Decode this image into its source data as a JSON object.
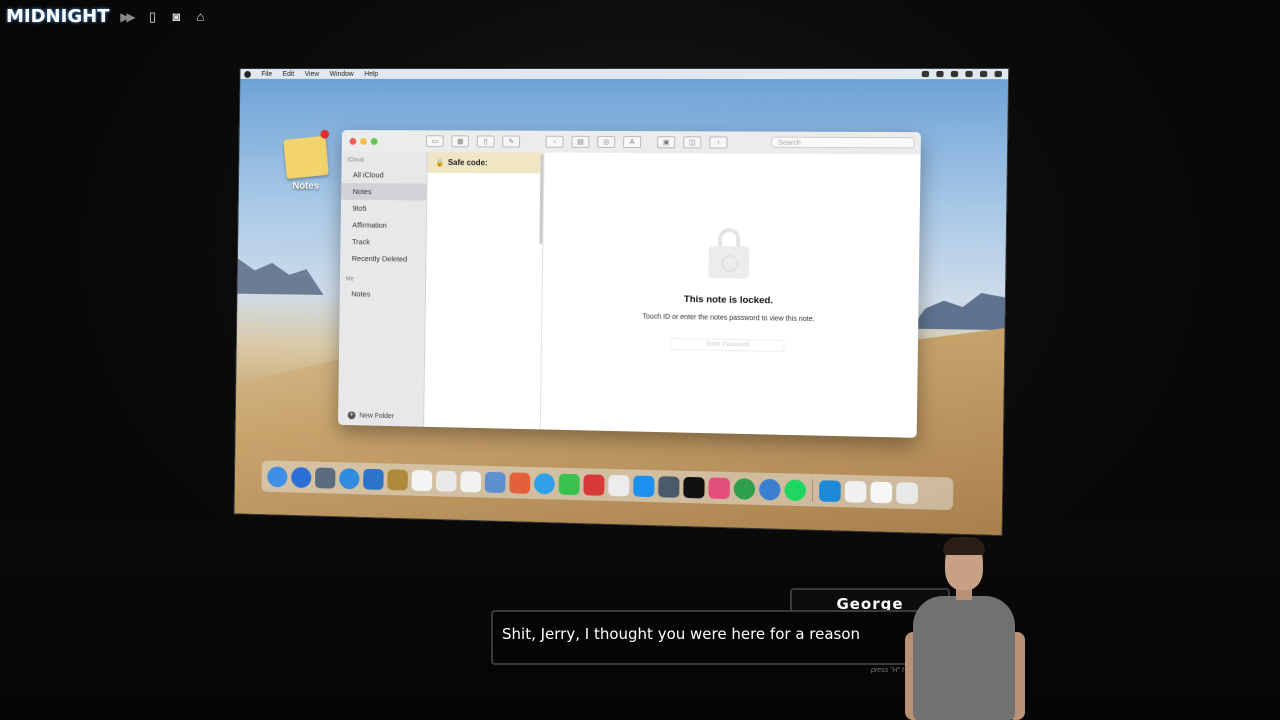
{
  "game": {
    "logo": "MIDNIGHT",
    "hud_icons": [
      "skip-icon",
      "phone-icon",
      "bag-icon",
      "inbox-icon"
    ]
  },
  "mac": {
    "menubar": [
      "File",
      "Edit",
      "View",
      "Window",
      "Help"
    ],
    "desktop_icon_label": "Notes",
    "search_placeholder": "Search",
    "sidebar": {
      "section_icloud": "iCloud",
      "icloud_items": [
        "All iCloud",
        "Notes",
        "9to5",
        "Affirmation",
        "Track",
        "Recently Deleted"
      ],
      "selected": "Notes",
      "section_me": "Me",
      "me_items": [
        "Notes"
      ],
      "new_folder": "New Folder"
    },
    "note_title": "Safe code:",
    "locked": {
      "title": "This note is locked.",
      "subtitle": "Touch ID or enter the notes password to view this note.",
      "password_placeholder": "Enter Password"
    },
    "dock_colors": [
      "#3f8fe6",
      "#2c6fd6",
      "#5b6c80",
      "#2f8ce0",
      "#2d74c8",
      "#b08a3a",
      "#f4f4f4",
      "#e9e9e9",
      "#f2f2f2",
      "#5e8fcf",
      "#e45f3a",
      "#2ea1e8",
      "#3ac24f",
      "#d83a3a",
      "#ececec",
      "#1d8fef",
      "#4a5a6a",
      "#111111",
      "#e34e7a",
      "#2f9f4d",
      "#3a7fd0",
      "#1ed760",
      "#1e88d8",
      "#f0f0f0",
      "#f6f6f6",
      "#e9e9e9"
    ]
  },
  "dialogue": {
    "speaker": "George",
    "text": "Shit, Jerry, I thought you were here for a reason",
    "hint": "press \"H\" t"
  }
}
